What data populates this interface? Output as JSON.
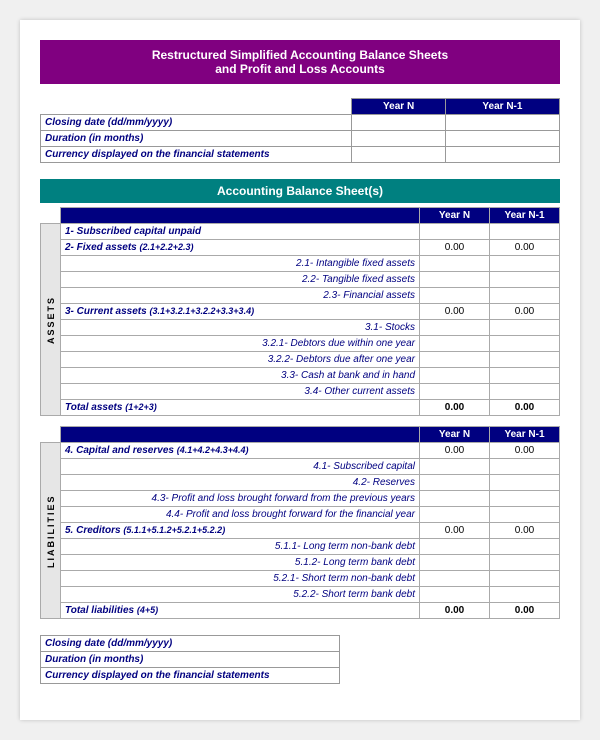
{
  "title": {
    "line1": "Restructured Simplified Accounting Balance Sheets",
    "line2": "and Profit and Loss Accounts"
  },
  "top_table": {
    "headers": [
      "Year N",
      "Year N-1"
    ],
    "rows": [
      "Closing date (dd/mm/yyyy)",
      "Duration (in months)",
      "Currency displayed on the financial statements"
    ]
  },
  "balance_sheet": {
    "title": "Accounting Balance Sheet(s)",
    "col_headers": [
      "Year N",
      "Year N-1"
    ],
    "assets_label": "ASSETS",
    "liabilities_label": "LIABILITIES",
    "assets_rows": [
      {
        "label": "1- Subscribed capital unpaid",
        "bold": true,
        "indent": false,
        "year_n": "",
        "year_n1": ""
      },
      {
        "label": "2- Fixed assets (2.1+2.2+2.3)",
        "bold": true,
        "indent": false,
        "year_n": "0.00",
        "year_n1": "0.00"
      },
      {
        "label": "2.1- Intangible fixed assets",
        "bold": false,
        "indent": true,
        "year_n": "",
        "year_n1": ""
      },
      {
        "label": "2.2- Tangible fixed assets",
        "bold": false,
        "indent": true,
        "year_n": "",
        "year_n1": ""
      },
      {
        "label": "2.3- Financial assets",
        "bold": false,
        "indent": true,
        "year_n": "",
        "year_n1": ""
      },
      {
        "label": "3- Current assets (3.1+3.2.1+3.2.2+3.3+3.4)",
        "bold": true,
        "indent": false,
        "year_n": "0.00",
        "year_n1": "0.00"
      },
      {
        "label": "3.1- Stocks",
        "bold": false,
        "indent": true,
        "year_n": "",
        "year_n1": ""
      },
      {
        "label": "3.2.1- Debtors due within one year",
        "bold": false,
        "indent": true,
        "year_n": "",
        "year_n1": ""
      },
      {
        "label": "3.2.2- Debtors due after one year",
        "bold": false,
        "indent": true,
        "year_n": "",
        "year_n1": ""
      },
      {
        "label": "3.3- Cash at bank and in hand",
        "bold": false,
        "indent": true,
        "year_n": "",
        "year_n1": ""
      },
      {
        "label": "3.4- Other current assets",
        "bold": false,
        "indent": true,
        "year_n": "",
        "year_n1": ""
      },
      {
        "label": "Total assets (1+2+3)",
        "bold": true,
        "indent": false,
        "total": true,
        "year_n": "0.00",
        "year_n1": "0.00"
      }
    ],
    "liabilities_rows": [
      {
        "label": "4. Capital and reserves (4.1+4.2+4.3+4.4)",
        "bold": true,
        "indent": false,
        "year_n": "0.00",
        "year_n1": "0.00"
      },
      {
        "label": "4.1- Subscribed capital",
        "bold": false,
        "indent": true,
        "year_n": "",
        "year_n1": ""
      },
      {
        "label": "4.2- Reserves",
        "bold": false,
        "indent": true,
        "year_n": "",
        "year_n1": ""
      },
      {
        "label": "4.3- Profit and loss brought forward from the previous years",
        "bold": false,
        "indent": true,
        "year_n": "",
        "year_n1": ""
      },
      {
        "label": "4.4- Profit and loss brought forward for the financial year",
        "bold": false,
        "indent": true,
        "year_n": "",
        "year_n1": ""
      },
      {
        "label": "5. Creditors (5.1.1+5.1.2+5.2.1+5.2.2)",
        "bold": true,
        "indent": false,
        "year_n": "0.00",
        "year_n1": "0.00"
      },
      {
        "label": "5.1.1- Long term non-bank debt",
        "bold": false,
        "indent": true,
        "year_n": "",
        "year_n1": ""
      },
      {
        "label": "5.1.2- Long term bank debt",
        "bold": false,
        "indent": true,
        "year_n": "",
        "year_n1": ""
      },
      {
        "label": "5.2.1- Short term non-bank debt",
        "bold": false,
        "indent": true,
        "year_n": "",
        "year_n1": ""
      },
      {
        "label": "5.2.2- Short term bank debt",
        "bold": false,
        "indent": true,
        "year_n": "",
        "year_n1": ""
      },
      {
        "label": "Total liabilities (4+5)",
        "bold": true,
        "indent": false,
        "total": true,
        "year_n": "0.00",
        "year_n1": "0.00"
      }
    ]
  },
  "bottom_table": {
    "rows": [
      "Closing date (dd/mm/yyyy)",
      "Duration (in months)",
      "Currency displayed on the financial statements"
    ]
  }
}
